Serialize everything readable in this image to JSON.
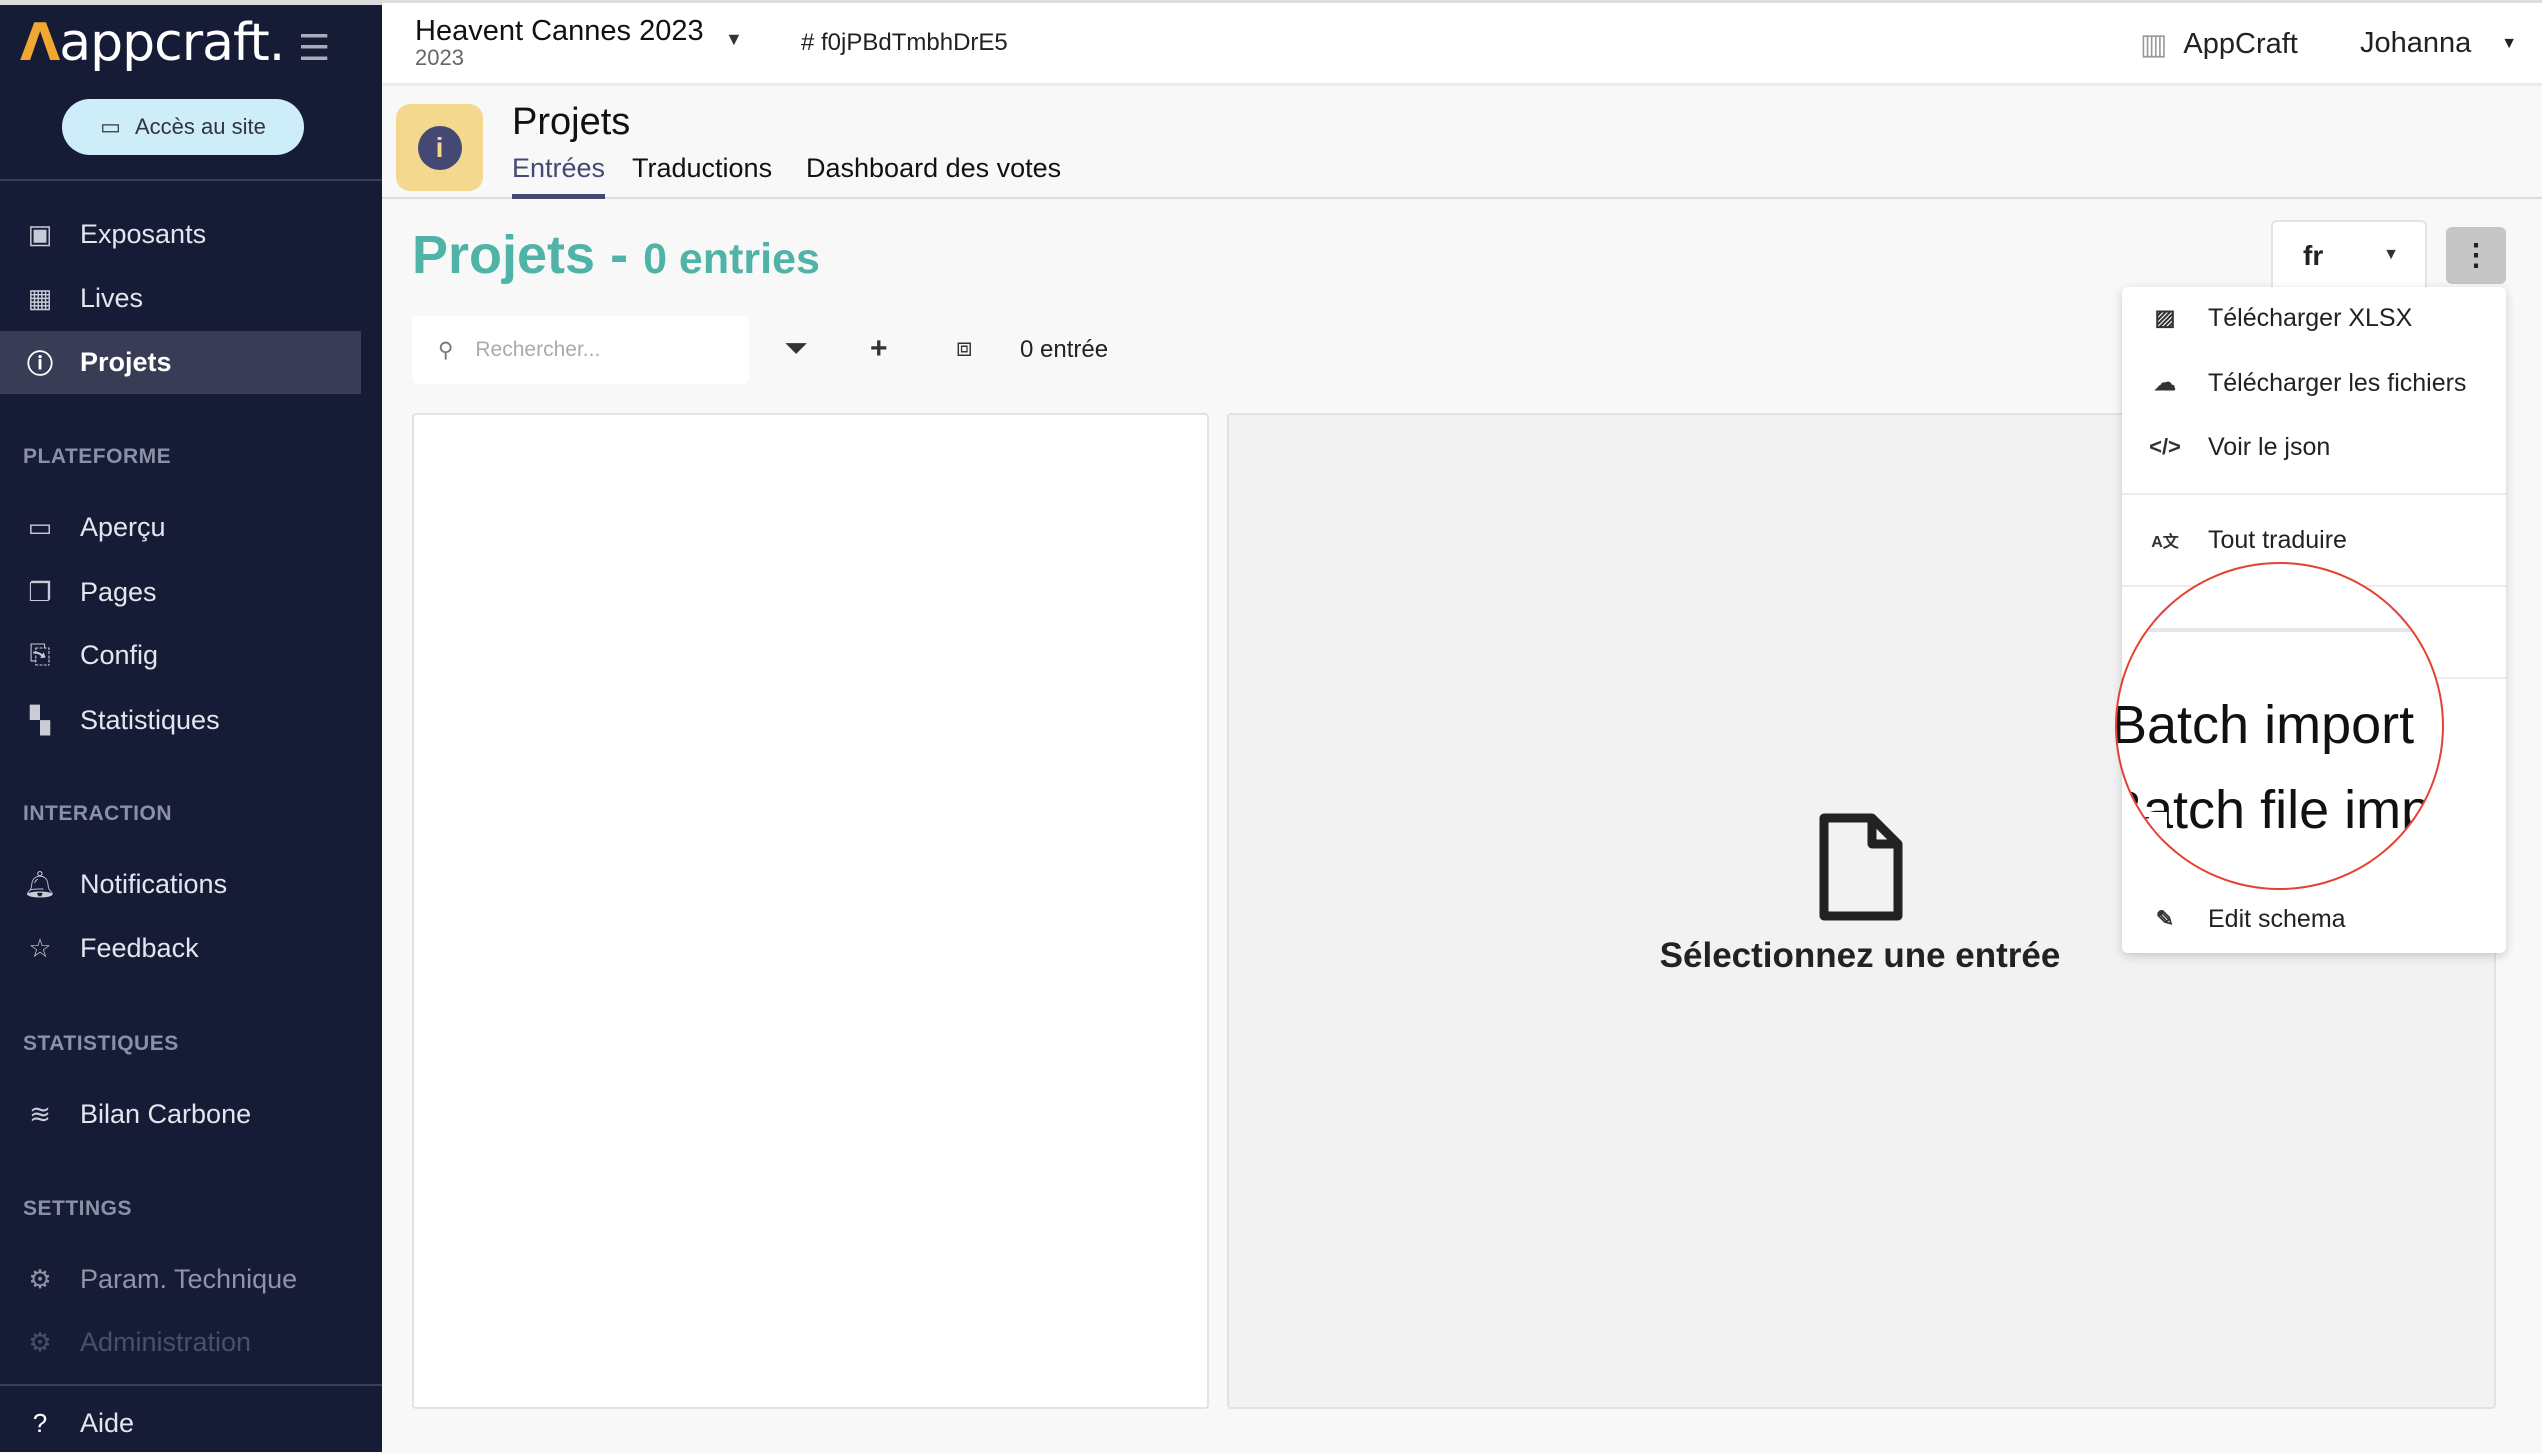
{
  "sidebar": {
    "logo": "appcraft.",
    "access_button": "Accès au site",
    "items": [
      {
        "label": "Exposants",
        "icon": "id-badge-icon"
      },
      {
        "label": "Lives",
        "icon": "calendar-icon"
      },
      {
        "label": "Projets",
        "icon": "info-circle-icon",
        "active": true
      }
    ],
    "sections": [
      {
        "title": "PLATEFORME",
        "items": [
          {
            "label": "Aperçu",
            "icon": "laptop-icon"
          },
          {
            "label": "Pages",
            "icon": "pages-icon"
          },
          {
            "label": "Config",
            "icon": "config-icon"
          },
          {
            "label": "Statistiques",
            "icon": "dashboard-icon"
          }
        ]
      },
      {
        "title": "INTERACTION",
        "items": [
          {
            "label": "Notifications",
            "icon": "bell-icon"
          },
          {
            "label": "Feedback",
            "icon": "star-icon"
          }
        ]
      },
      {
        "title": "STATISTIQUES",
        "items": [
          {
            "label": "Bilan Carbone",
            "icon": "chart-area-icon"
          }
        ]
      },
      {
        "title": "SETTINGS",
        "items": [
          {
            "label": "Param. Technique",
            "icon": "settings-box-icon"
          },
          {
            "label": "Administration",
            "icon": "gear-icon"
          }
        ]
      }
    ],
    "help": "Aide"
  },
  "topbar": {
    "event_title": "Heavent Cannes 2023",
    "event_year": "2023",
    "event_id": "f0jPBdTmbhDrE5",
    "org": "AppCraft",
    "user": "Johanna"
  },
  "page": {
    "title": "Projets",
    "tabs": [
      "Entrées",
      "Traductions",
      "Dashboard des votes"
    ],
    "active_tab": "Entrées"
  },
  "main": {
    "heading": "Projets - ",
    "entries": "0 entries",
    "accent_color": "#50b3a8",
    "search_placeholder": "Rechercher...",
    "count": "0 entrée",
    "empty_text": "Sélectionnez une entrée",
    "language": "fr"
  },
  "menu": {
    "items": [
      "Télécharger XLSX",
      "Télécharger les fichiers",
      "Voir le json",
      "Tout traduire"
    ],
    "magnified": [
      "Batch import",
      "Batch file import"
    ],
    "edit": "Edit schema",
    "highlight_color": "#e4422f"
  }
}
